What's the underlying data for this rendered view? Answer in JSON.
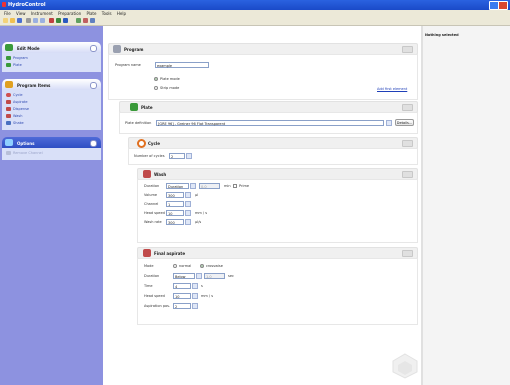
{
  "window": {
    "title": "HydroControl"
  },
  "menu": [
    "File",
    "View",
    "Instrument",
    "Preparation",
    "Plate",
    "Tools",
    "Help"
  ],
  "sidebar": {
    "panels": [
      {
        "title": "Edit Mode",
        "items": [
          {
            "label": "Program"
          },
          {
            "label": "Plate"
          }
        ]
      },
      {
        "title": "Program Items",
        "items": [
          {
            "label": "Cycle"
          },
          {
            "label": "Aspirate"
          },
          {
            "label": "Dispense"
          },
          {
            "label": "Wash"
          },
          {
            "label": "Shake"
          }
        ]
      },
      {
        "title": "Options",
        "items": [
          {
            "label": "Remove Channel"
          }
        ]
      }
    ]
  },
  "right_pane": {
    "label": "Nothing selected"
  },
  "program": {
    "header": "Program",
    "name_label": "Program name",
    "name_value": "example",
    "mode_plate": "Plate mode",
    "mode_strip": "Strip mode",
    "add_link": "Add first element"
  },
  "plate": {
    "header": "Plate",
    "label": "Plate definition",
    "value": "[GRE 96] - Greiner 96 Flat Transparent",
    "details_button": "Details..."
  },
  "cycle": {
    "header": "Cycle",
    "cycles_label": "Number of cycles",
    "cycles_value": "2"
  },
  "wash": {
    "header": "Wash",
    "duration_label": "Duration",
    "duration_value": "Duration",
    "duration_num": "0.0",
    "duration_unit": "min",
    "prime_label": "Prime",
    "volume_label": "Volume",
    "volume_value": "300",
    "volume_unit": "µl",
    "channel_label": "Channel",
    "channel_value": "1",
    "headspeed_label": "Head speed",
    "headspeed_value": "10",
    "headspeed_unit": "mm / s",
    "washrate_label": "Wash rate",
    "washrate_value": "300",
    "washrate_unit": "µl/s"
  },
  "final": {
    "header": "Final aspirate",
    "mode_label": "Mode",
    "mode_normal": "normal",
    "mode_crosswise": "crosswise",
    "duration_label": "Duration",
    "duration_value": "Below",
    "duration_num": "1.0",
    "duration_unit": "sec",
    "time_label": "Time",
    "time_value": "4",
    "time_unit": "s",
    "headspeed_label": "Head speed",
    "headspeed_value": "10",
    "headspeed_unit": "mm / s",
    "aspiration_label": "Aspiration pos.",
    "aspiration_value": "2"
  }
}
